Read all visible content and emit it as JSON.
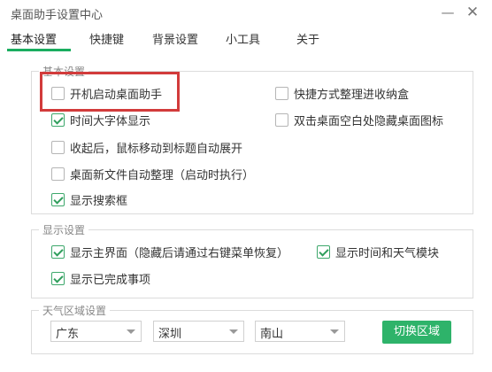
{
  "window": {
    "title": "桌面助手设置中心",
    "min_glyph": "—",
    "close_glyph": "✕"
  },
  "tabs": [
    {
      "label": "基本设置",
      "active": true
    },
    {
      "label": "快捷键",
      "active": false
    },
    {
      "label": "背景设置",
      "active": false
    },
    {
      "label": "小工具",
      "active": false
    },
    {
      "label": "关于",
      "active": false
    }
  ],
  "basic": {
    "legend": "基本设置",
    "options": [
      {
        "label": "开机启动桌面助手",
        "checked": false
      },
      {
        "label": "快捷方式整理进收纳盒",
        "checked": false
      },
      {
        "label": "时间大字体显示",
        "checked": true
      },
      {
        "label": "双击桌面空白处隐藏桌面图标",
        "checked": false
      },
      {
        "label": "收起后，鼠标移动到标题自动展开",
        "checked": false
      },
      {
        "label": "桌面新文件自动整理（启动时执行）",
        "checked": false
      },
      {
        "label": "显示搜索框",
        "checked": true
      }
    ]
  },
  "display": {
    "legend": "显示设置",
    "options": [
      {
        "label": "显示主界面（隐藏后请通过右键菜单恢复）",
        "checked": true
      },
      {
        "label": "显示时间和天气模块",
        "checked": true
      },
      {
        "label": "显示已完成事项",
        "checked": true
      }
    ]
  },
  "weather": {
    "legend": "天气区域设置",
    "province": "广东",
    "city": "深圳",
    "district": "南山",
    "switch_label": "切换区域"
  },
  "colors": {
    "accent": "#2eb36a",
    "highlight_border": "#d23b3b"
  }
}
